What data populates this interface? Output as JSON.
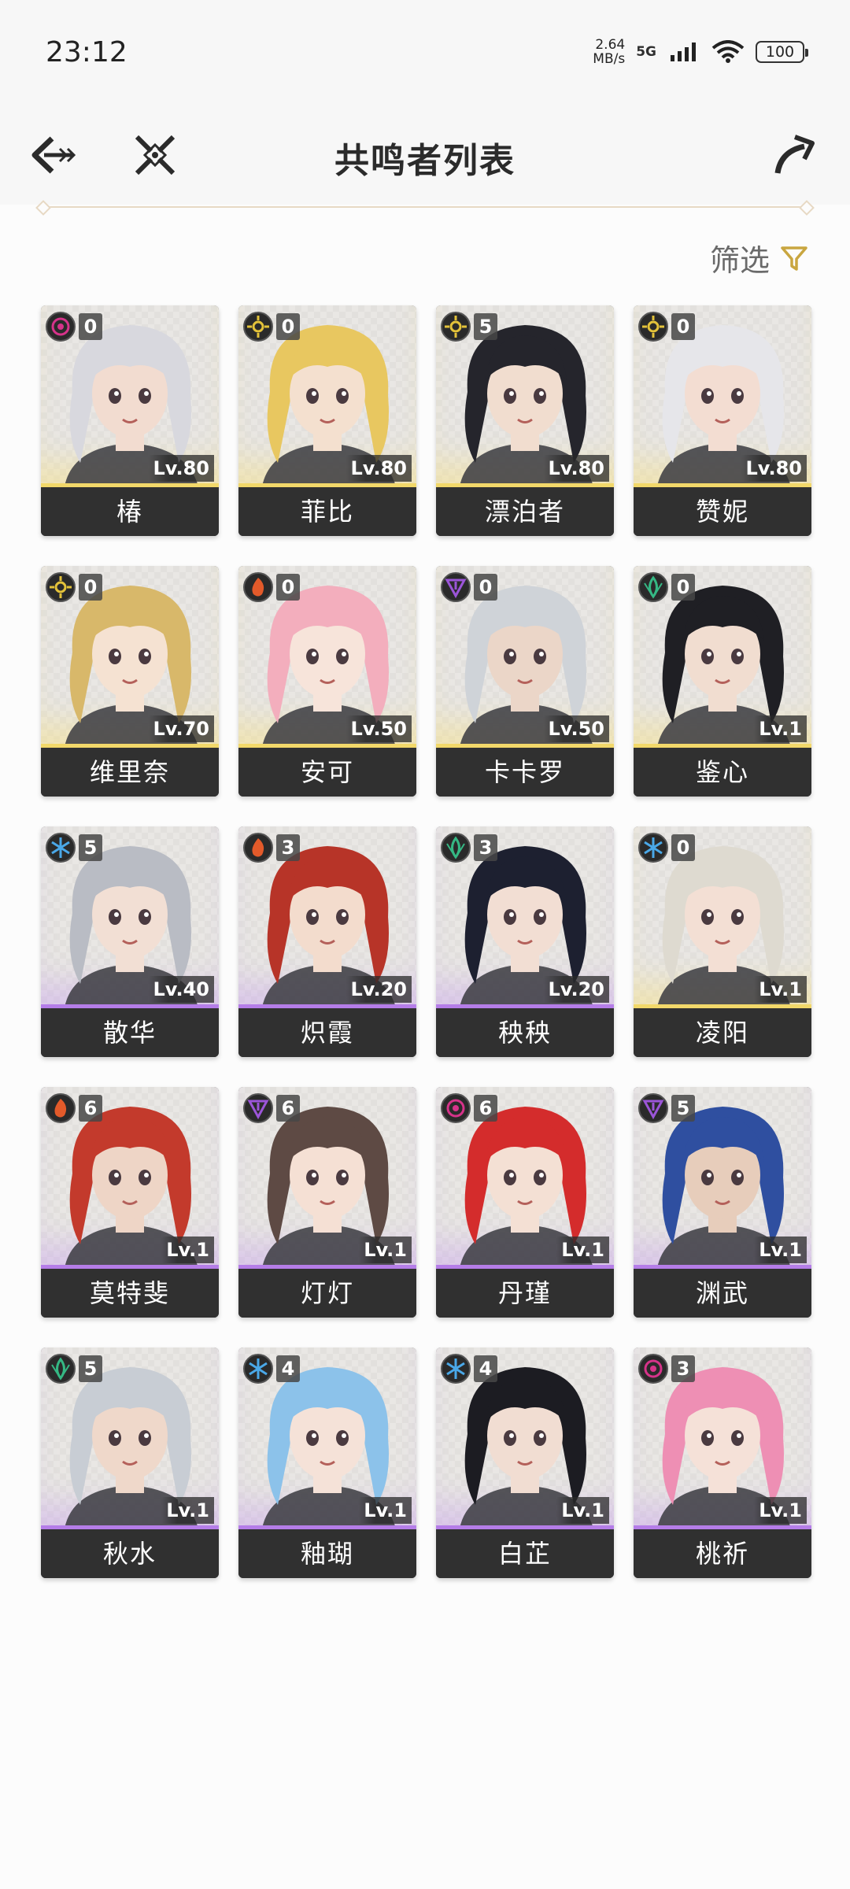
{
  "status_bar": {
    "time": "23:12",
    "net_speed_value": "2.64",
    "net_speed_unit": "MB/s",
    "network_type": "5G",
    "battery": "100"
  },
  "header": {
    "title": "共鸣者列表",
    "back_icon": "back-arrow-icon",
    "close_icon": "cross-close-icon",
    "share_icon": "share-arrow-icon"
  },
  "filter": {
    "label": "筛选",
    "icon": "filter-funnel-icon"
  },
  "colors": {
    "gold_accent": "#c9a640",
    "rarity5": "#f2d86a",
    "rarity4": "#b57de8",
    "card_bar": "#303030"
  },
  "characters": [
    {
      "name": "椿",
      "level": "Lv.80",
      "chain": "0",
      "element": "havoc",
      "rarity": 5,
      "hair": "#d8d8de",
      "skin": "#f2dcd0"
    },
    {
      "name": "菲比",
      "level": "Lv.80",
      "chain": "0",
      "element": "spectro",
      "rarity": 5,
      "hair": "#e8c760",
      "skin": "#f4e0cf"
    },
    {
      "name": "漂泊者",
      "level": "Lv.80",
      "chain": "5",
      "element": "spectro",
      "rarity": 5,
      "hair": "#25252c",
      "skin": "#f1ddcf"
    },
    {
      "name": "赞妮",
      "level": "Lv.80",
      "chain": "0",
      "element": "spectro",
      "rarity": 5,
      "hair": "#e6e6ea",
      "skin": "#f3ddd2"
    },
    {
      "name": "维里奈",
      "level": "Lv.70",
      "chain": "0",
      "element": "spectro",
      "rarity": 5,
      "hair": "#d8b86a",
      "skin": "#f5e2d2"
    },
    {
      "name": "安可",
      "level": "Lv.50",
      "chain": "0",
      "element": "fusion",
      "rarity": 5,
      "hair": "#f3aebd",
      "skin": "#f7e4da"
    },
    {
      "name": "卡卡罗",
      "level": "Lv.50",
      "chain": "0",
      "element": "electro",
      "rarity": 5,
      "hair": "#cfd3d8",
      "skin": "#ebd6c8"
    },
    {
      "name": "鉴心",
      "level": "Lv.1",
      "chain": "0",
      "element": "aero",
      "rarity": 5,
      "hair": "#1f1f24",
      "skin": "#f1ddd0"
    },
    {
      "name": "散华",
      "level": "Lv.40",
      "chain": "5",
      "element": "glacio",
      "rarity": 4,
      "hair": "#b9bcc4",
      "skin": "#f2dfd4"
    },
    {
      "name": "炽霞",
      "level": "Lv.20",
      "chain": "3",
      "element": "fusion",
      "rarity": 4,
      "hair": "#b73428",
      "skin": "#f3dccd"
    },
    {
      "name": "秧秧",
      "level": "Lv.20",
      "chain": "3",
      "element": "aero",
      "rarity": 4,
      "hair": "#1d2030",
      "skin": "#f2ded3"
    },
    {
      "name": "凌阳",
      "level": "Lv.1",
      "chain": "0",
      "element": "glacio",
      "rarity": 5,
      "hair": "#dedad0",
      "skin": "#f3dfd4"
    },
    {
      "name": "莫特斐",
      "level": "Lv.1",
      "chain": "6",
      "element": "fusion",
      "rarity": 4,
      "hair": "#c33a2c",
      "skin": "#eed5c6"
    },
    {
      "name": "灯灯",
      "level": "Lv.1",
      "chain": "6",
      "element": "electro",
      "rarity": 4,
      "hair": "#5e4a44",
      "skin": "#f5e0d4"
    },
    {
      "name": "丹瑾",
      "level": "Lv.1",
      "chain": "6",
      "element": "havoc",
      "rarity": 4,
      "hair": "#d42c2c",
      "skin": "#f4e0d4"
    },
    {
      "name": "渊武",
      "level": "Lv.1",
      "chain": "5",
      "element": "electro",
      "rarity": 4,
      "hair": "#2f4fa0",
      "skin": "#e7cdbb"
    },
    {
      "name": "秋水",
      "level": "Lv.1",
      "chain": "5",
      "element": "aero",
      "rarity": 4,
      "hair": "#c8cdd4",
      "skin": "#efd8ca"
    },
    {
      "name": "釉瑚",
      "level": "Lv.1",
      "chain": "4",
      "element": "glacio",
      "rarity": 4,
      "hair": "#8cc2ea",
      "skin": "#f5e2d8"
    },
    {
      "name": "白芷",
      "level": "Lv.1",
      "chain": "4",
      "element": "glacio",
      "rarity": 4,
      "hair": "#1c1c22",
      "skin": "#f1ddd2"
    },
    {
      "name": "桃祈",
      "level": "Lv.1",
      "chain": "3",
      "element": "havoc",
      "rarity": 4,
      "hair": "#ee8fb4",
      "skin": "#f5e1d8"
    }
  ]
}
